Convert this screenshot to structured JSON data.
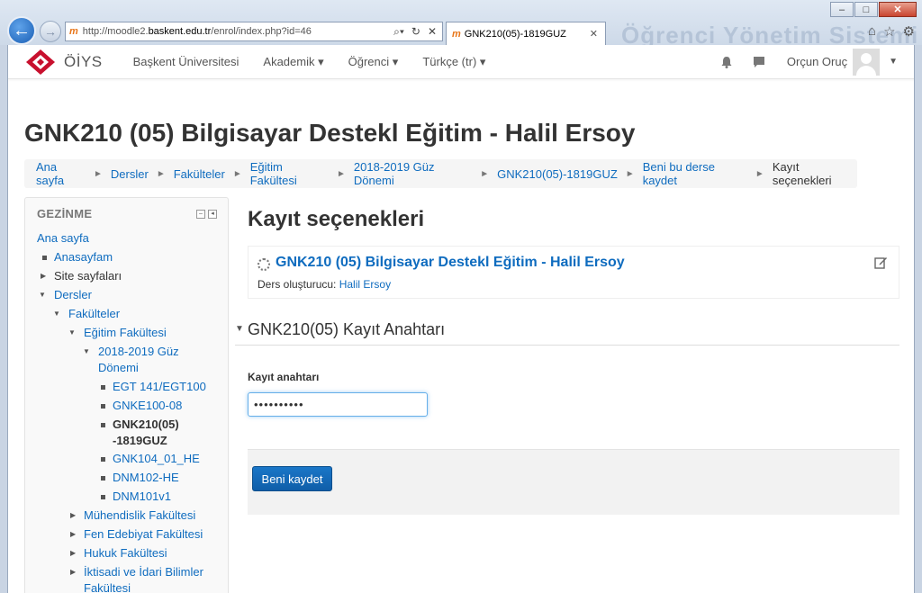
{
  "browser": {
    "url_prefix": "http://moodle2.",
    "url_domain": "baskent.edu.tr",
    "url_path": "/enrol/index.php?id=46",
    "tab_title": "GNK210(05)-1819GUZ",
    "bg_watermark": "Öğrenci Yönetim Sistemi"
  },
  "navbar": {
    "brand": "ÖİYS",
    "links": [
      "Başkent Üniversitesi",
      "Akademik",
      "Öğrenci",
      "Türkçe (tr)"
    ],
    "user_name": "Orçun Oruç"
  },
  "header": {
    "title": "GNK210 (05) Bilgisayar Destekl Eğitim - Halil Ersoy",
    "breadcrumb": [
      "Ana sayfa",
      "Dersler",
      "Fakülteler",
      "Eğitim Fakültesi",
      "2018-2019 Güz Dönemi",
      "GNK210(05)-1819GUZ",
      "Beni bu derse kaydet",
      "Kayıt seçenekleri"
    ]
  },
  "sidebar": {
    "heading": "GEZİNME",
    "items": [
      {
        "label": "Ana sayfa"
      },
      {
        "label": "Anasayfam"
      },
      {
        "label": "Site sayfaları"
      },
      {
        "label": "Dersler"
      },
      {
        "label": "Fakülteler"
      },
      {
        "label": "Eğitim Fakültesi"
      },
      {
        "label": "2018-2019 Güz"
      },
      {
        "label": "Dönemi"
      },
      {
        "label": "EGT 141/EGT100"
      },
      {
        "label": "GNKE100-08"
      },
      {
        "label": "GNK210(05)"
      },
      {
        "label": "-1819GUZ"
      },
      {
        "label": "GNK104_01_HE"
      },
      {
        "label": "DNM102-HE"
      },
      {
        "label": "DNM101v1"
      },
      {
        "label": "Mühendislik Fakültesi"
      },
      {
        "label": "Fen Edebiyat Fakültesi"
      },
      {
        "label": "Hukuk Fakültesi"
      },
      {
        "label": "İktisadi ve İdari Bilimler"
      },
      {
        "label": "Fakültesi"
      }
    ]
  },
  "main": {
    "heading": "Kayıt seçenekleri",
    "course": {
      "title": "GNK210 (05) Bilgisayar Destekl Eğitim - Halil Ersoy",
      "teacher_label": "Ders oluşturucu:",
      "teacher_name": "Halil Ersoy"
    },
    "section_title": "GNK210(05) Kayıt Anahtarı",
    "enrol_key_label": "Kayıt anahtarı",
    "enrol_key_value": "••••••••••",
    "submit_label": "Beni kaydet"
  },
  "colors": {
    "link": "#0f6cbf",
    "button": "#0f6cbf",
    "logo_red": "#c8102e"
  }
}
